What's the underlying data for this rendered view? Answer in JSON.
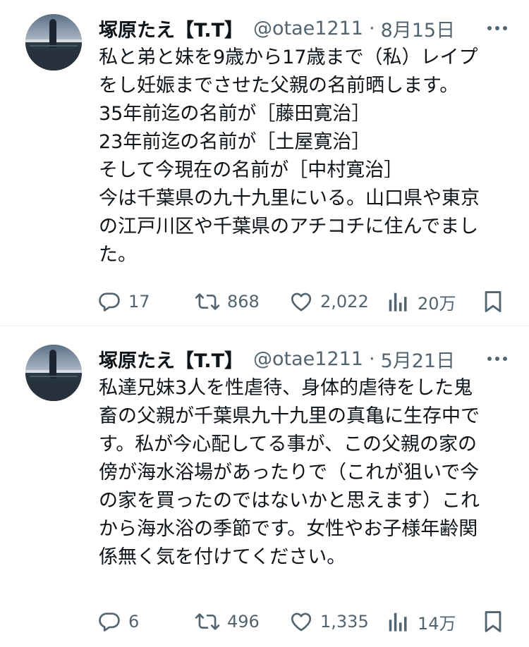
{
  "tweets": [
    {
      "author_name": "塚原たえ【T.T】",
      "handle": "@otae1211",
      "separator": "·",
      "date": "8月15日",
      "lines": [
        "私と弟と妹を9歳から17歳まで（私）レイプ",
        "をし妊娠までさせた父親の名前晒します。",
        "35年前迄の名前が［藤田寛治］",
        "23年前迄の名前が［土屋寛治］",
        "そして今現在の名前が［中村寛治］",
        "今は千葉県の九十九里にいる。山口県や東京",
        "の江戸川区や千葉県のアチコチに住んでまし",
        "た。"
      ],
      "replies": "17",
      "retweets": "868",
      "likes": "2,022",
      "views": "20万"
    },
    {
      "author_name": "塚原たえ【T.T】",
      "handle": "@otae1211",
      "separator": "·",
      "date": "5月21日",
      "lines": [
        "私達兄妹3人を性虐待、身体的虐待をした鬼",
        "畜の父親が千葉県九十九里の真亀に生存中で",
        "す。私が今心配してる事が、この父親の家の",
        "傍が海水浴場があったりで（これが狙いで今",
        "の家を買ったのではないかと思えます）これ",
        "から海水浴の季節です。女性やお子様年齢関",
        "係無く気を付けてください。"
      ],
      "replies": "6",
      "retweets": "496",
      "likes": "1,335",
      "views": "14万"
    }
  ],
  "icons": {
    "more": "more-horizontal-icon",
    "reply": "reply-bubble-icon",
    "retweet": "retweet-arrows-icon",
    "like": "heart-icon",
    "views": "bar-chart-icon",
    "bookmark": "bookmark-icon"
  },
  "colors": {
    "text": "#0f1419",
    "secondary": "#536471",
    "divider": "#eff3f4"
  }
}
